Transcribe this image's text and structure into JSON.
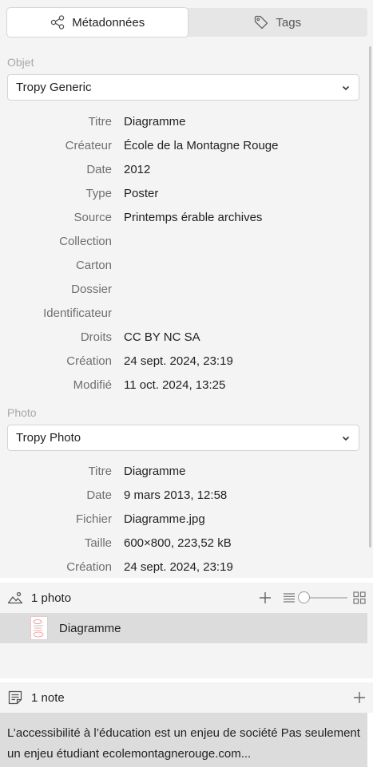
{
  "tabs": {
    "metadata_label": "Métadonnées",
    "tags_label": "Tags"
  },
  "object_section": {
    "label": "Objet",
    "template": "Tropy Generic",
    "fields": [
      {
        "label": "Titre",
        "value": "Diagramme"
      },
      {
        "label": "Créateur",
        "value": "École de la Montagne Rouge"
      },
      {
        "label": "Date",
        "value": "2012"
      },
      {
        "label": "Type",
        "value": "Poster"
      },
      {
        "label": "Source",
        "value": "Printemps érable archives"
      },
      {
        "label": "Collection",
        "value": ""
      },
      {
        "label": "Carton",
        "value": ""
      },
      {
        "label": "Dossier",
        "value": ""
      },
      {
        "label": "Identificateur",
        "value": ""
      },
      {
        "label": "Droits",
        "value": "CC BY NC SA"
      },
      {
        "label": "Création",
        "value": "24 sept. 2024, 23:19"
      },
      {
        "label": "Modifié",
        "value": "11 oct. 2024, 13:25"
      }
    ]
  },
  "photo_section": {
    "label": "Photo",
    "template": "Tropy Photo",
    "fields": [
      {
        "label": "Titre",
        "value": "Diagramme"
      },
      {
        "label": "Date",
        "value": "9 mars 2013, 12:58"
      },
      {
        "label": "Fichier",
        "value": "Diagramme.jpg"
      },
      {
        "label": "Taille",
        "value": "600×800, 223,52 kB"
      },
      {
        "label": "Création",
        "value": "24 sept. 2024, 23:19"
      }
    ]
  },
  "photos_panel": {
    "count_label": "1 photo",
    "items": [
      {
        "name": "Diagramme"
      }
    ]
  },
  "notes_panel": {
    "count_label": "1 note",
    "items": [
      {
        "text": "L’accessibilité à l’éducation est un enjeu de société Pas seulement un enjeu étudiant ecolemontagnerouge.com..."
      }
    ]
  },
  "icons": {
    "metadata_tab": "share-nodes-icon",
    "tags_tab": "tag-icon",
    "dropdown": "chevron-down-icon",
    "photos": "photo-icon",
    "add": "plus-icon",
    "list_view": "list-view-icon",
    "grid_view": "grid-view-icon",
    "notes": "note-icon"
  }
}
